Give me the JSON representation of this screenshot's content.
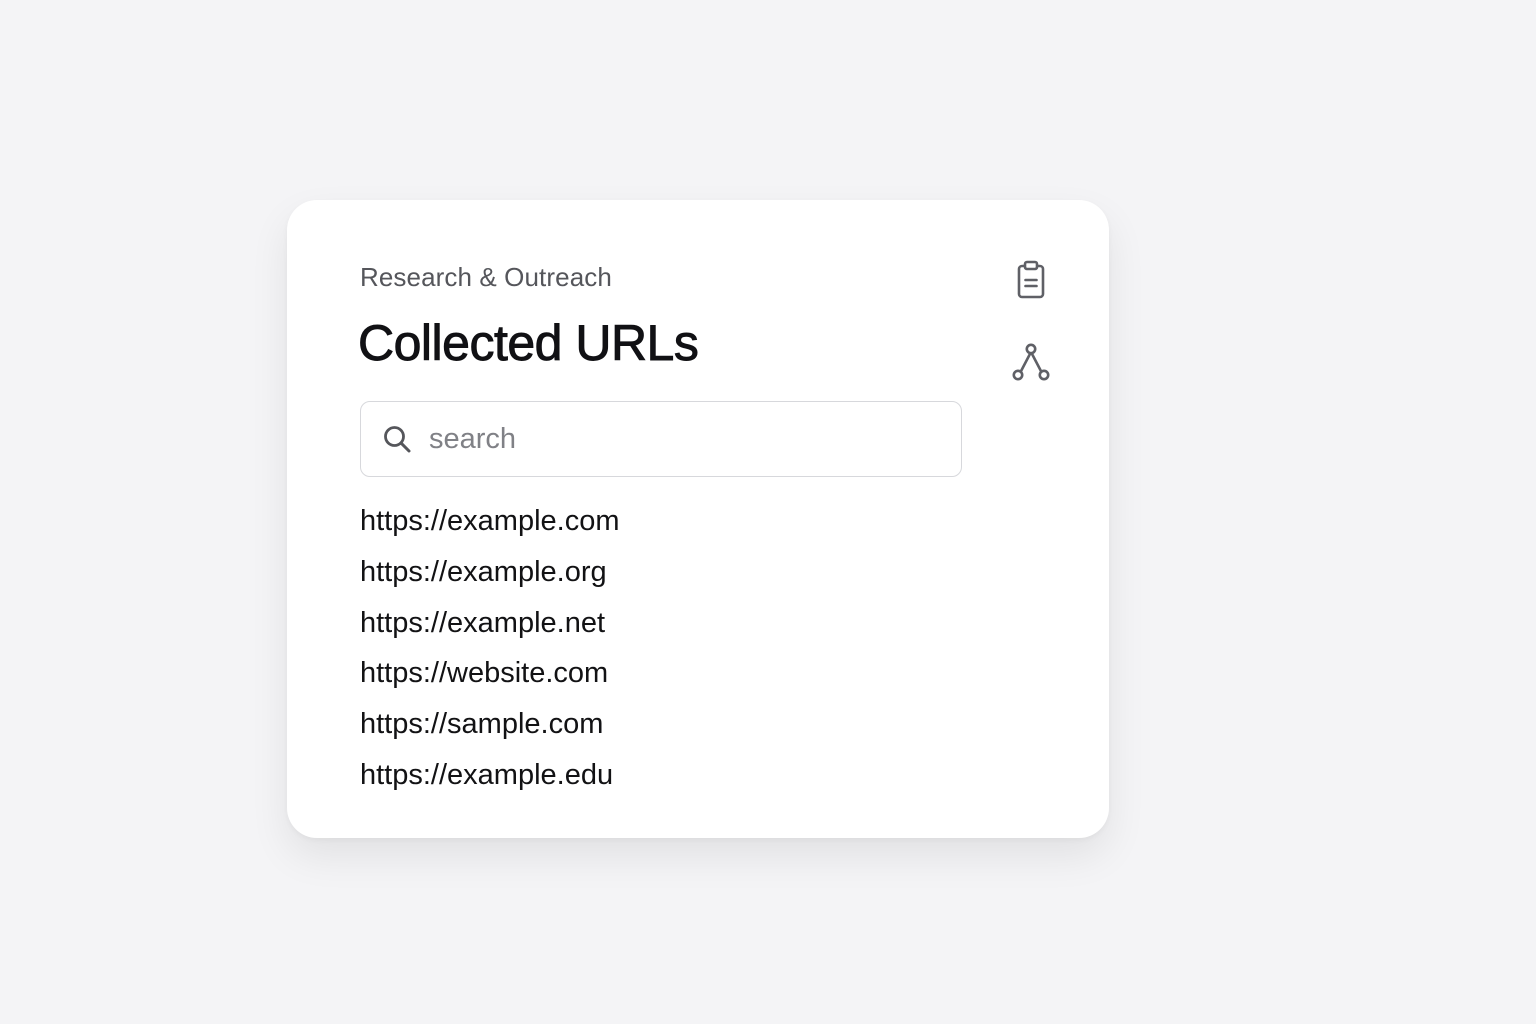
{
  "header": {
    "subtitle": "Research & Outreach",
    "title": "Collected URLs"
  },
  "search": {
    "placeholder": "search",
    "value": "",
    "icon": "search-icon"
  },
  "actions": {
    "copy_icon": "clipboard-icon",
    "share_icon": "share-nodes-icon"
  },
  "urls": [
    "https://example.com",
    "https://example.org",
    "https://example.net",
    "https://website.com",
    "https://sample.com",
    "https://example.edu"
  ],
  "colors": {
    "background": "#f4f4f6",
    "card": "#ffffff",
    "title": "#111114",
    "subtitle": "#55565b",
    "icon": "#5f6066"
  }
}
